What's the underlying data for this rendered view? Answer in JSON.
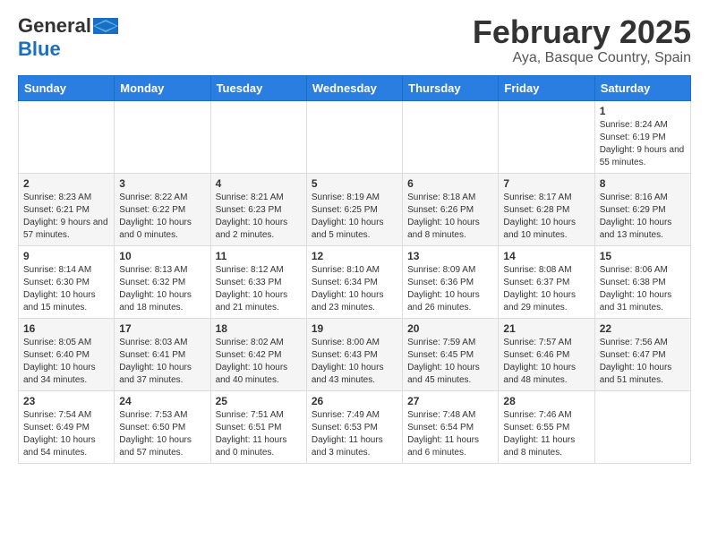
{
  "header": {
    "logo_general": "General",
    "logo_blue": "Blue",
    "month_title": "February 2025",
    "location": "Aya, Basque Country, Spain"
  },
  "days_of_week": [
    "Sunday",
    "Monday",
    "Tuesday",
    "Wednesday",
    "Thursday",
    "Friday",
    "Saturday"
  ],
  "weeks": [
    [
      {
        "day": "",
        "info": ""
      },
      {
        "day": "",
        "info": ""
      },
      {
        "day": "",
        "info": ""
      },
      {
        "day": "",
        "info": ""
      },
      {
        "day": "",
        "info": ""
      },
      {
        "day": "",
        "info": ""
      },
      {
        "day": "1",
        "info": "Sunrise: 8:24 AM\nSunset: 6:19 PM\nDaylight: 9 hours and 55 minutes."
      }
    ],
    [
      {
        "day": "2",
        "info": "Sunrise: 8:23 AM\nSunset: 6:21 PM\nDaylight: 9 hours and 57 minutes."
      },
      {
        "day": "3",
        "info": "Sunrise: 8:22 AM\nSunset: 6:22 PM\nDaylight: 10 hours and 0 minutes."
      },
      {
        "day": "4",
        "info": "Sunrise: 8:21 AM\nSunset: 6:23 PM\nDaylight: 10 hours and 2 minutes."
      },
      {
        "day": "5",
        "info": "Sunrise: 8:19 AM\nSunset: 6:25 PM\nDaylight: 10 hours and 5 minutes."
      },
      {
        "day": "6",
        "info": "Sunrise: 8:18 AM\nSunset: 6:26 PM\nDaylight: 10 hours and 8 minutes."
      },
      {
        "day": "7",
        "info": "Sunrise: 8:17 AM\nSunset: 6:28 PM\nDaylight: 10 hours and 10 minutes."
      },
      {
        "day": "8",
        "info": "Sunrise: 8:16 AM\nSunset: 6:29 PM\nDaylight: 10 hours and 13 minutes."
      }
    ],
    [
      {
        "day": "9",
        "info": "Sunrise: 8:14 AM\nSunset: 6:30 PM\nDaylight: 10 hours and 15 minutes."
      },
      {
        "day": "10",
        "info": "Sunrise: 8:13 AM\nSunset: 6:32 PM\nDaylight: 10 hours and 18 minutes."
      },
      {
        "day": "11",
        "info": "Sunrise: 8:12 AM\nSunset: 6:33 PM\nDaylight: 10 hours and 21 minutes."
      },
      {
        "day": "12",
        "info": "Sunrise: 8:10 AM\nSunset: 6:34 PM\nDaylight: 10 hours and 23 minutes."
      },
      {
        "day": "13",
        "info": "Sunrise: 8:09 AM\nSunset: 6:36 PM\nDaylight: 10 hours and 26 minutes."
      },
      {
        "day": "14",
        "info": "Sunrise: 8:08 AM\nSunset: 6:37 PM\nDaylight: 10 hours and 29 minutes."
      },
      {
        "day": "15",
        "info": "Sunrise: 8:06 AM\nSunset: 6:38 PM\nDaylight: 10 hours and 31 minutes."
      }
    ],
    [
      {
        "day": "16",
        "info": "Sunrise: 8:05 AM\nSunset: 6:40 PM\nDaylight: 10 hours and 34 minutes."
      },
      {
        "day": "17",
        "info": "Sunrise: 8:03 AM\nSunset: 6:41 PM\nDaylight: 10 hours and 37 minutes."
      },
      {
        "day": "18",
        "info": "Sunrise: 8:02 AM\nSunset: 6:42 PM\nDaylight: 10 hours and 40 minutes."
      },
      {
        "day": "19",
        "info": "Sunrise: 8:00 AM\nSunset: 6:43 PM\nDaylight: 10 hours and 43 minutes."
      },
      {
        "day": "20",
        "info": "Sunrise: 7:59 AM\nSunset: 6:45 PM\nDaylight: 10 hours and 45 minutes."
      },
      {
        "day": "21",
        "info": "Sunrise: 7:57 AM\nSunset: 6:46 PM\nDaylight: 10 hours and 48 minutes."
      },
      {
        "day": "22",
        "info": "Sunrise: 7:56 AM\nSunset: 6:47 PM\nDaylight: 10 hours and 51 minutes."
      }
    ],
    [
      {
        "day": "23",
        "info": "Sunrise: 7:54 AM\nSunset: 6:49 PM\nDaylight: 10 hours and 54 minutes."
      },
      {
        "day": "24",
        "info": "Sunrise: 7:53 AM\nSunset: 6:50 PM\nDaylight: 10 hours and 57 minutes."
      },
      {
        "day": "25",
        "info": "Sunrise: 7:51 AM\nSunset: 6:51 PM\nDaylight: 11 hours and 0 minutes."
      },
      {
        "day": "26",
        "info": "Sunrise: 7:49 AM\nSunset: 6:53 PM\nDaylight: 11 hours and 3 minutes."
      },
      {
        "day": "27",
        "info": "Sunrise: 7:48 AM\nSunset: 6:54 PM\nDaylight: 11 hours and 6 minutes."
      },
      {
        "day": "28",
        "info": "Sunrise: 7:46 AM\nSunset: 6:55 PM\nDaylight: 11 hours and 8 minutes."
      },
      {
        "day": "",
        "info": ""
      }
    ]
  ]
}
